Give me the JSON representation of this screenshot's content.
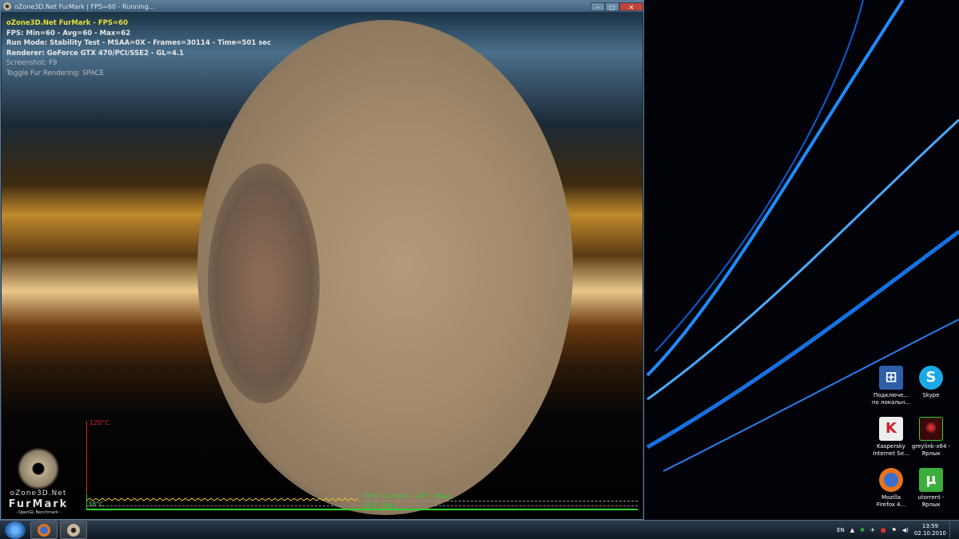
{
  "window": {
    "title": "oZone3D.Net FurMark | FPS=60 - Running...",
    "buttons": {
      "minimize": "–",
      "maximize": "□",
      "close": "✕"
    }
  },
  "hud": {
    "line1": "oZone3D.Net FurMark - FPS=60",
    "line2": "FPS: Min=60 - Avg=60 - Max=62",
    "line3": "Run Mode: Stability Test - MSAA=0X - Frames=30114 - Time=501 sec",
    "line4": "Renderer: GeForce GTX 470/PCI/SSE2 - GL=4.1",
    "line5": "Screenshot: F9",
    "line6": "Toggle Fur Rendering: SPACE"
  },
  "logo": {
    "line1": "oZone3D.Net",
    "line2": "FurMark",
    "line3": "- OpenGL Benchmark -"
  },
  "temperature": {
    "max_axis": "120°C",
    "start_label": "38°C",
    "current_max": "39°C (Current) - 40°C (Max)",
    "min": "30°C (Min)",
    "current_value": 39,
    "axis_max_value": 120,
    "color_line": "#e6c63a",
    "color_axis": "#2ed12e"
  },
  "desktop_icons": [
    {
      "label1": "Подключе...",
      "label2": "по локальн...",
      "icon": "network-connection-icon"
    },
    {
      "label1": "Skype",
      "label2": "",
      "icon": "skype-icon"
    },
    {
      "label1": "Kaspersky",
      "label2": "Internet Se...",
      "icon": "kaspersky-icon"
    },
    {
      "label1": "greylink-x64 -",
      "label2": "Ярлык",
      "icon": "greylink-icon"
    },
    {
      "label1": "Mozilla",
      "label2": "Firefox 4...",
      "icon": "firefox-icon"
    },
    {
      "label1": "utorrent -",
      "label2": "Ярлык",
      "icon": "utorrent-icon"
    }
  ],
  "taskbar": {
    "lang": "EN",
    "time": "13:59",
    "date": "02.10.2010"
  }
}
